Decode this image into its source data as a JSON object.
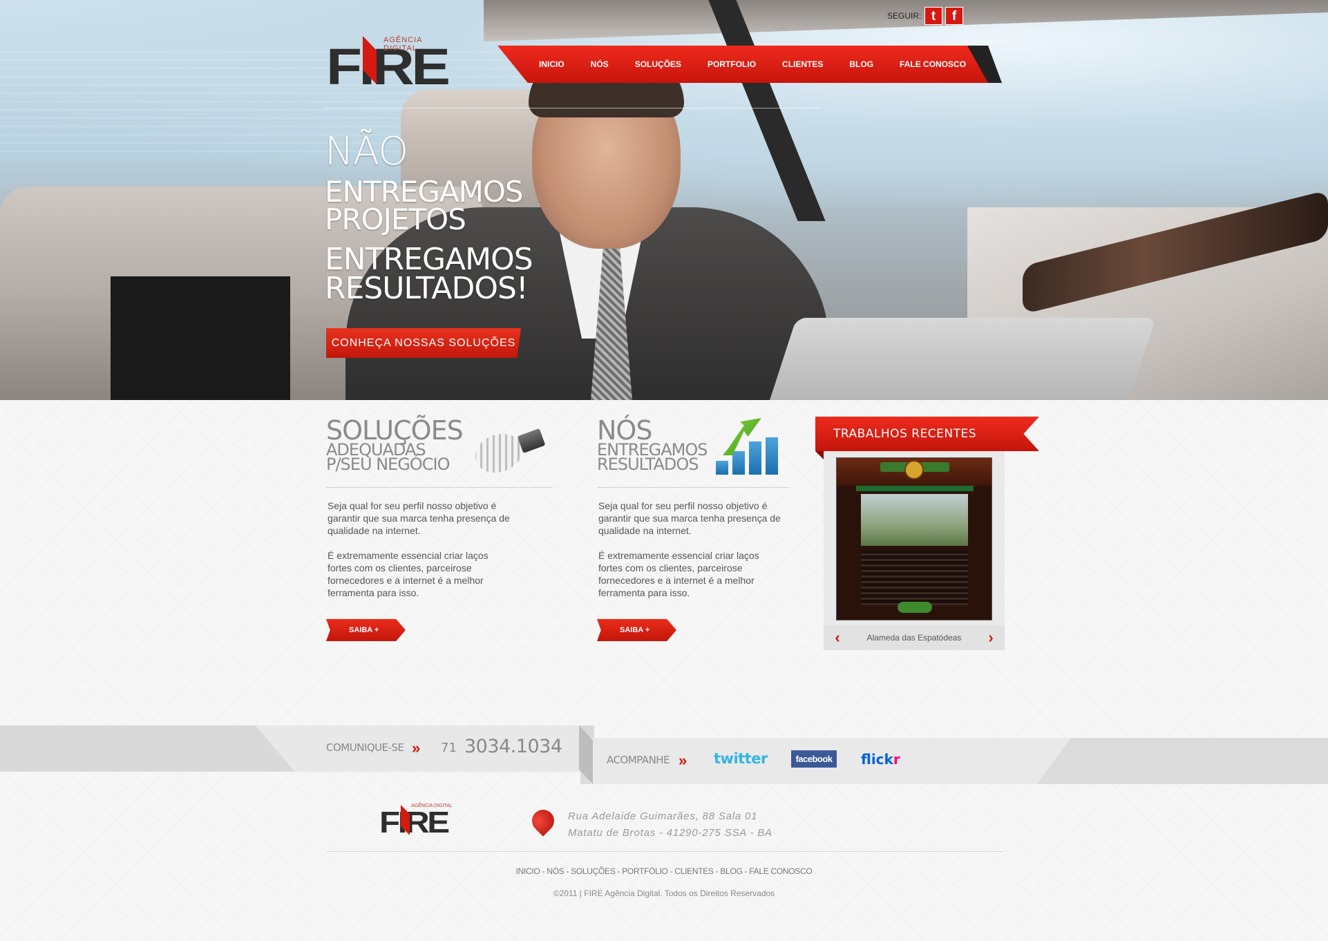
{
  "social": {
    "label": "SEGUIR:",
    "twitter_glyph": "t",
    "facebook_glyph": "f"
  },
  "logo": {
    "word": "FIRE",
    "tagline": "AGÊNCIA DIGITAL"
  },
  "nav": {
    "items": [
      "INICIO",
      "NÓS",
      "SOLUÇÕES",
      "PORTFOLIO",
      "CLIENTES",
      "BLOG",
      "FALE CONOSCO"
    ]
  },
  "hero": {
    "line1": "NÃO",
    "line2a": "ENTREGAMOS",
    "line2b": "PROJETOS",
    "line3a": "ENTREGAMOS",
    "line3b": "RESULTADOS!",
    "cta": "CONHEÇA NOSSAS SOLUÇÕES"
  },
  "solutions": {
    "title_big": "SOLUÇÕES",
    "title_small1": "ADEQUADAS",
    "title_small2": "P/SEU NEGÓCIO",
    "para1": "Seja qual for seu perfil nosso objetivo é garantir que sua marca tenha presença de qualidade na internet.",
    "para2": "É extremamente essencial criar laços fortes com os clientes, parceirose fornecedores e a internet é a melhor ferramenta para isso.",
    "button": "SAIBA +"
  },
  "about": {
    "title_big": "NÓS",
    "title_small1": "ENTREGAMOS",
    "title_small2": "RESULTADOS",
    "para1": "Seja qual for seu perfil nosso objetivo é garantir que sua marca tenha presença de qualidade na internet.",
    "para2": "É extremamente essencial criar laços fortes com os clientes, parceirose fornecedores e a internet é a melhor ferramenta para isso.",
    "button": "SAIBA +"
  },
  "recent": {
    "title": "TRABALHOS RECENTES",
    "caption": "Alameda das Espatódeas",
    "prev": "‹",
    "next": "›"
  },
  "contact": {
    "label": "COMUNIQUE-SE",
    "ddd": "71",
    "phone": "3034.1034",
    "follow_label": "ACOMPANHE",
    "twitter": "twitter",
    "facebook": "facebook",
    "flickr_a": "flick",
    "flickr_b": "r",
    "chevrons": "»"
  },
  "footer": {
    "address1": "Rua Adelaide Guimarães, 88 Sala 01",
    "address2": "Matatu de Brotas - 41290-275 SSA - BA",
    "links": "INICIO - NÓS - SOLUÇÕES - PORTFÓLIO - CLIENTES - BLOG - FALE CONOSCO",
    "copyright": "©2011 | FIRE Agência Digital. Todos os Direitos Reservados"
  },
  "colors": {
    "accent": "#d51a12",
    "text_gray": "#888888"
  }
}
